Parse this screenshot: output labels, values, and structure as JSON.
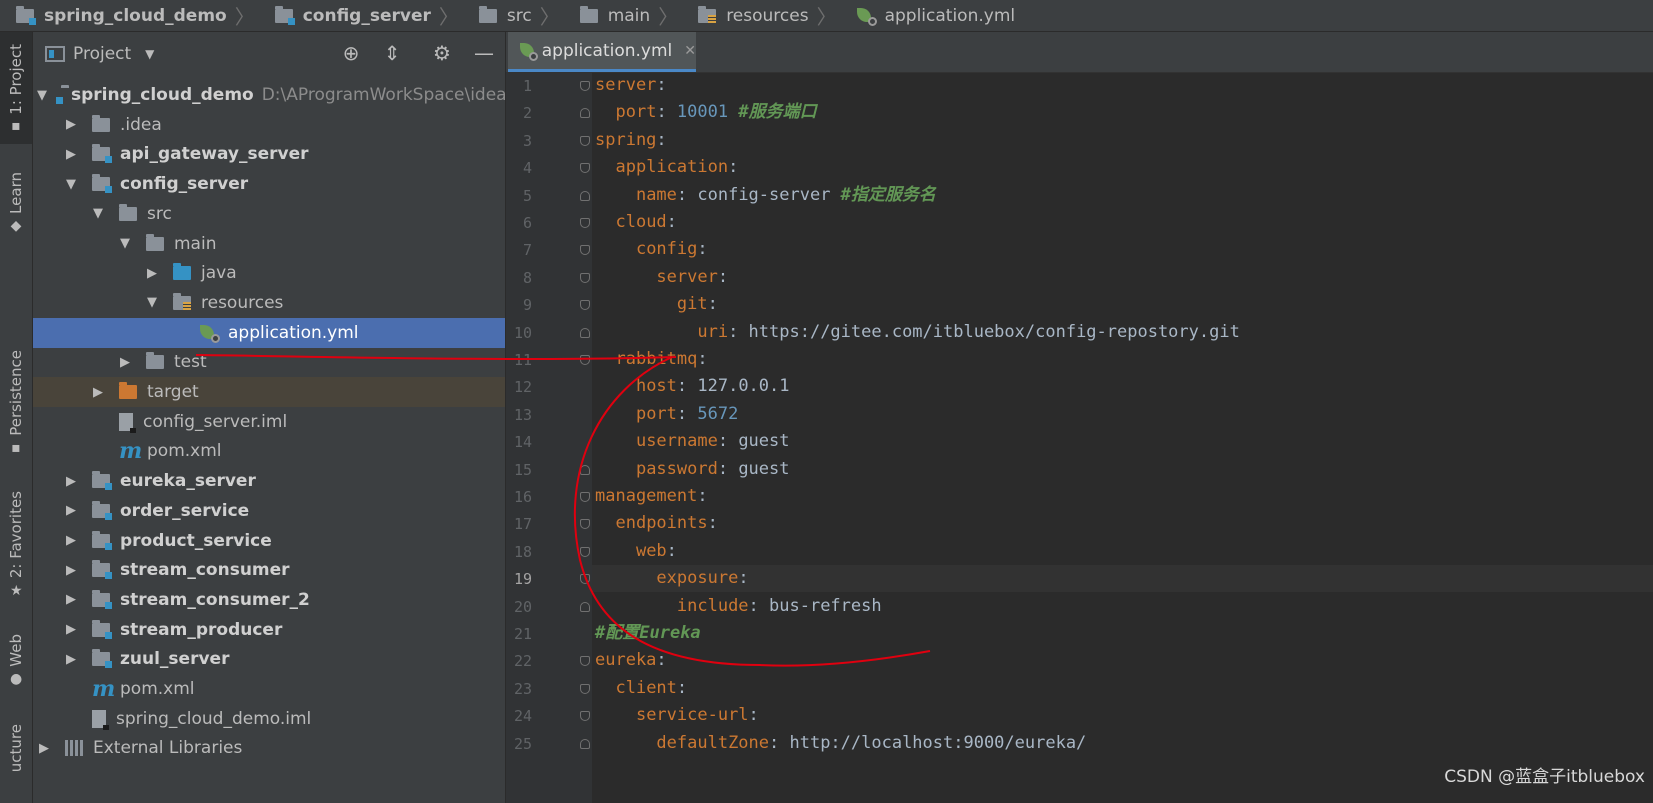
{
  "breadcrumb": [
    {
      "label": "spring_cloud_demo",
      "icon": "module-folder-icon",
      "bold": true
    },
    {
      "label": "config_server",
      "icon": "module-folder-icon",
      "bold": true
    },
    {
      "label": "src",
      "icon": "folder-icon",
      "bold": false
    },
    {
      "label": "main",
      "icon": "folder-icon",
      "bold": false
    },
    {
      "label": "resources",
      "icon": "resources-folder-icon",
      "bold": false
    },
    {
      "label": "application.yml",
      "icon": "spring-config-file-icon",
      "bold": false
    }
  ],
  "toolstrip": {
    "project_tab": "1: Project",
    "learn_tab": "Learn",
    "persistence_tab": "Persistence",
    "favorites_tab": "2: Favorites",
    "web_tab": "Web",
    "structure_tab": "ucture"
  },
  "project_panel": {
    "title": "Project",
    "tree": [
      {
        "label": "spring_cloud_demo",
        "path": "D:\\AProgramWorkSpace\\idea\\sp",
        "indent": 0,
        "arrow": "down",
        "icon": "module-folder-icon",
        "bold": true
      },
      {
        "label": ".idea",
        "indent": 1,
        "arrow": "right",
        "icon": "folder-icon"
      },
      {
        "label": "api_gateway_server",
        "indent": 1,
        "arrow": "right",
        "icon": "module-folder-icon",
        "bold": true
      },
      {
        "label": "config_server",
        "indent": 1,
        "arrow": "down",
        "icon": "module-folder-icon",
        "bold": true
      },
      {
        "label": "src",
        "indent": 2,
        "arrow": "down",
        "icon": "folder-icon"
      },
      {
        "label": "main",
        "indent": 3,
        "arrow": "down",
        "icon": "folder-icon"
      },
      {
        "label": "java",
        "indent": 4,
        "arrow": "right",
        "icon": "source-folder-icon"
      },
      {
        "label": "resources",
        "indent": 4,
        "arrow": "down",
        "icon": "resources-folder-icon"
      },
      {
        "label": "application.yml",
        "indent": 5,
        "arrow": "",
        "icon": "spring-config-file-icon",
        "selected": true
      },
      {
        "label": "test",
        "indent": 3,
        "arrow": "right",
        "icon": "folder-icon"
      },
      {
        "label": "target",
        "indent": 2,
        "arrow": "right",
        "icon": "excluded-folder-icon",
        "excluded": true
      },
      {
        "label": "config_server.iml",
        "indent": 2,
        "arrow": "",
        "icon": "iml-file-icon"
      },
      {
        "label": "pom.xml",
        "indent": 2,
        "arrow": "",
        "icon": "maven-icon"
      },
      {
        "label": "eureka_server",
        "indent": 1,
        "arrow": "right",
        "icon": "module-folder-icon",
        "bold": true
      },
      {
        "label": "order_service",
        "indent": 1,
        "arrow": "right",
        "icon": "module-folder-icon",
        "bold": true
      },
      {
        "label": "product_service",
        "indent": 1,
        "arrow": "right",
        "icon": "module-folder-icon",
        "bold": true
      },
      {
        "label": "stream_consumer",
        "indent": 1,
        "arrow": "right",
        "icon": "module-folder-icon",
        "bold": true
      },
      {
        "label": "stream_consumer_2",
        "indent": 1,
        "arrow": "right",
        "icon": "module-folder-icon",
        "bold": true
      },
      {
        "label": "stream_producer",
        "indent": 1,
        "arrow": "right",
        "icon": "module-folder-icon",
        "bold": true
      },
      {
        "label": "zuul_server",
        "indent": 1,
        "arrow": "right",
        "icon": "module-folder-icon",
        "bold": true
      },
      {
        "label": "pom.xml",
        "indent": 1,
        "arrow": "",
        "icon": "maven-icon"
      },
      {
        "label": "spring_cloud_demo.iml",
        "indent": 1,
        "arrow": "",
        "icon": "iml-file-icon"
      },
      {
        "label": "External Libraries",
        "indent": 0,
        "arrow": "right",
        "icon": "libraries-icon"
      }
    ]
  },
  "editor": {
    "tab_label": "application.yml",
    "current_line": 19,
    "lines": [
      {
        "n": "1",
        "tokens": [
          [
            "k",
            "server"
          ],
          [
            "v",
            ":"
          ]
        ]
      },
      {
        "n": "2",
        "tokens": [
          [
            "v",
            "  "
          ],
          [
            "k",
            "port"
          ],
          [
            "v",
            ": "
          ],
          [
            "n",
            "10001"
          ],
          [
            "v",
            " "
          ],
          [
            "c",
            "#服务端口"
          ]
        ]
      },
      {
        "n": "3",
        "tokens": [
          [
            "k",
            "spring"
          ],
          [
            "v",
            ":"
          ]
        ]
      },
      {
        "n": "4",
        "tokens": [
          [
            "v",
            "  "
          ],
          [
            "k",
            "application"
          ],
          [
            "v",
            ":"
          ]
        ]
      },
      {
        "n": "5",
        "tokens": [
          [
            "v",
            "    "
          ],
          [
            "k",
            "name"
          ],
          [
            "v",
            ": config-server "
          ],
          [
            "c",
            "#指定服务名"
          ]
        ]
      },
      {
        "n": "6",
        "tokens": [
          [
            "v",
            "  "
          ],
          [
            "k",
            "cloud"
          ],
          [
            "v",
            ":"
          ]
        ]
      },
      {
        "n": "7",
        "tokens": [
          [
            "v",
            "    "
          ],
          [
            "k",
            "config"
          ],
          [
            "v",
            ":"
          ]
        ]
      },
      {
        "n": "8",
        "tokens": [
          [
            "v",
            "      "
          ],
          [
            "k",
            "server"
          ],
          [
            "v",
            ":"
          ]
        ]
      },
      {
        "n": "9",
        "tokens": [
          [
            "v",
            "        "
          ],
          [
            "k",
            "git"
          ],
          [
            "v",
            ":"
          ]
        ]
      },
      {
        "n": "10",
        "tokens": [
          [
            "v",
            "          "
          ],
          [
            "k",
            "uri"
          ],
          [
            "v",
            ": https://gitee.com/itbluebox/config-repostory.git"
          ]
        ]
      },
      {
        "n": "11",
        "tokens": [
          [
            "v",
            "  "
          ],
          [
            "k",
            "rabbitmq"
          ],
          [
            "v",
            ":"
          ]
        ]
      },
      {
        "n": "12",
        "tokens": [
          [
            "v",
            "    "
          ],
          [
            "k",
            "host"
          ],
          [
            "v",
            ": 127.0.0.1"
          ]
        ]
      },
      {
        "n": "13",
        "tokens": [
          [
            "v",
            "    "
          ],
          [
            "k",
            "port"
          ],
          [
            "v",
            ": "
          ],
          [
            "n",
            "5672"
          ]
        ]
      },
      {
        "n": "14",
        "tokens": [
          [
            "v",
            "    "
          ],
          [
            "k",
            "username"
          ],
          [
            "v",
            ": guest"
          ]
        ]
      },
      {
        "n": "15",
        "tokens": [
          [
            "v",
            "    "
          ],
          [
            "k",
            "password"
          ],
          [
            "v",
            ": guest"
          ]
        ]
      },
      {
        "n": "16",
        "tokens": [
          [
            "k",
            "management"
          ],
          [
            "v",
            ":"
          ]
        ]
      },
      {
        "n": "17",
        "tokens": [
          [
            "v",
            "  "
          ],
          [
            "k",
            "endpoints"
          ],
          [
            "v",
            ":"
          ]
        ]
      },
      {
        "n": "18",
        "tokens": [
          [
            "v",
            "    "
          ],
          [
            "k",
            "web"
          ],
          [
            "v",
            ":"
          ]
        ]
      },
      {
        "n": "19",
        "tokens": [
          [
            "v",
            "      "
          ],
          [
            "k",
            "exposure"
          ],
          [
            "v",
            ":"
          ]
        ]
      },
      {
        "n": "20",
        "tokens": [
          [
            "v",
            "        "
          ],
          [
            "k",
            "include"
          ],
          [
            "v",
            ": bus-refresh"
          ]
        ]
      },
      {
        "n": "21",
        "tokens": [
          [
            "c",
            "#配置Eureka"
          ]
        ]
      },
      {
        "n": "22",
        "tokens": [
          [
            "k",
            "eureka"
          ],
          [
            "v",
            ":"
          ]
        ]
      },
      {
        "n": "23",
        "tokens": [
          [
            "v",
            "  "
          ],
          [
            "k",
            "client"
          ],
          [
            "v",
            ":"
          ]
        ]
      },
      {
        "n": "24",
        "tokens": [
          [
            "v",
            "    "
          ],
          [
            "k",
            "service-url"
          ],
          [
            "v",
            ":"
          ]
        ]
      },
      {
        "n": "25",
        "tokens": [
          [
            "v",
            "      "
          ],
          [
            "k",
            "defaultZone"
          ],
          [
            "v",
            ": http://localhost:9000/eureka/"
          ]
        ]
      }
    ]
  },
  "watermark": "CSDN @蓝盒子itbluebox",
  "colors": {
    "keyword": "#cc7832",
    "number": "#6897bb",
    "comment": "#629755",
    "selection": "#4b6eaf",
    "annotation": "#e0000f"
  }
}
